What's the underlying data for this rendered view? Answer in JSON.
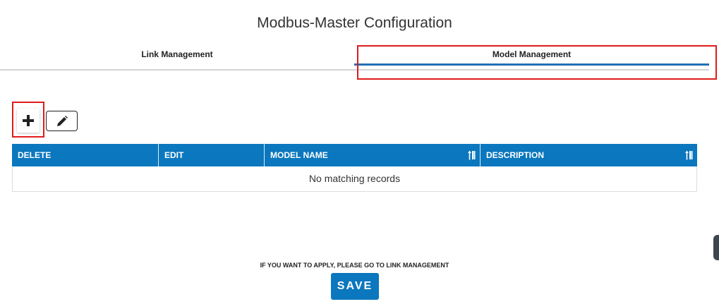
{
  "page": {
    "title": "Modbus-Master Configuration"
  },
  "tabs": [
    {
      "label": "Link Management",
      "active": false
    },
    {
      "label": "Model Management",
      "active": true
    }
  ],
  "toolbar": {
    "add_icon": "plus-icon",
    "edit_icon": "pencil-icon"
  },
  "table": {
    "columns": [
      {
        "label": "DELETE",
        "sortable": false
      },
      {
        "label": "EDIT",
        "sortable": false
      },
      {
        "label": "MODEL NAME",
        "sortable": true
      },
      {
        "label": "DESCRIPTION",
        "sortable": true
      }
    ],
    "empty_message": "No matching records"
  },
  "footer": {
    "note": "IF YOU WANT TO APPLY, PLEASE GO TO LINK MANAGEMENT",
    "save_label": "SAVE"
  },
  "colors": {
    "accent": "#0b77be",
    "highlight": "#e01b1b"
  }
}
